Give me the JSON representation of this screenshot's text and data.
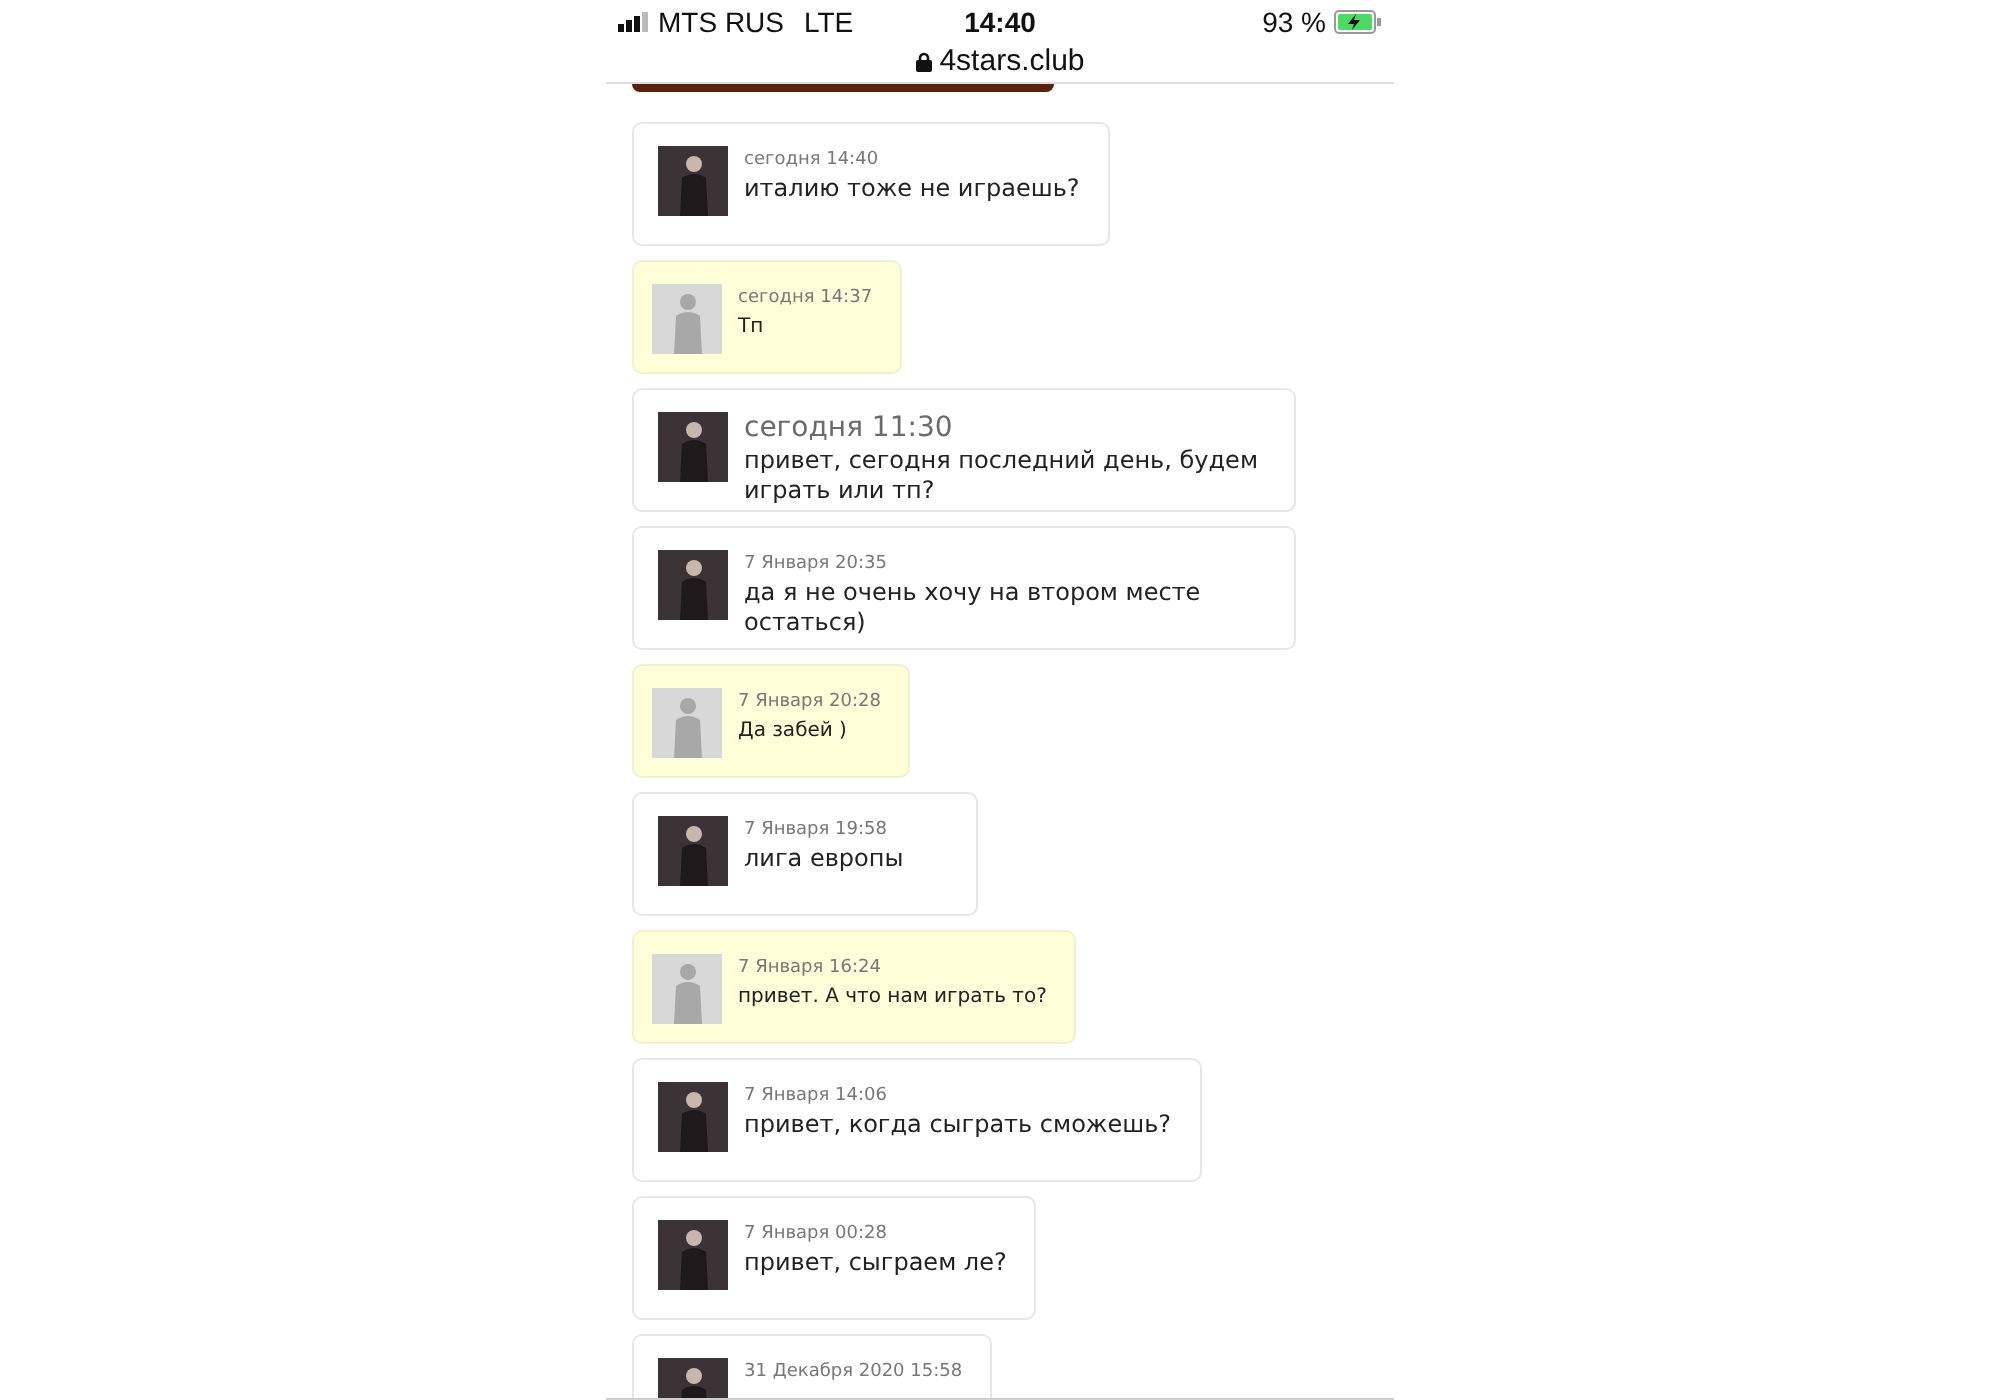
{
  "status_bar": {
    "carrier": "MTS RUS",
    "network": "LTE",
    "time": "14:40",
    "battery": "93 %",
    "charging": true
  },
  "address_bar": {
    "url": "4stars.club",
    "secure": true
  },
  "messages": [
    {
      "kind": "own",
      "time": "сегодня 14:40",
      "large_time": false,
      "text": "италию тоже не играешь?"
    },
    {
      "kind": "other",
      "time": "сегодня 14:37",
      "large_time": false,
      "text": "Тп"
    },
    {
      "kind": "own",
      "time": "сегодня 11:30",
      "large_time": true,
      "text": "привет, сегодня последний день, будем играть или тп?"
    },
    {
      "kind": "own",
      "time": "7 Января 20:35",
      "large_time": false,
      "text": "да я не очень хочу на втором месте остаться)"
    },
    {
      "kind": "other",
      "time": "7 Января 20:28",
      "large_time": false,
      "text": "Да забей )"
    },
    {
      "kind": "own",
      "time": "7 Января 19:58",
      "large_time": false,
      "text": "лига европы"
    },
    {
      "kind": "other",
      "time": "7 Января 16:24",
      "large_time": false,
      "text": "привет. А что нам играть то?"
    },
    {
      "kind": "own",
      "time": "7 Января 14:06",
      "large_time": false,
      "text": "привет, когда сыграть сможешь?"
    },
    {
      "kind": "own",
      "time": "7 Января 00:28",
      "large_time": false,
      "text": "привет, сыграем ле?"
    },
    {
      "kind": "own",
      "time": "31 Декабря 2020 15:58",
      "large_time": false
    }
  ]
}
